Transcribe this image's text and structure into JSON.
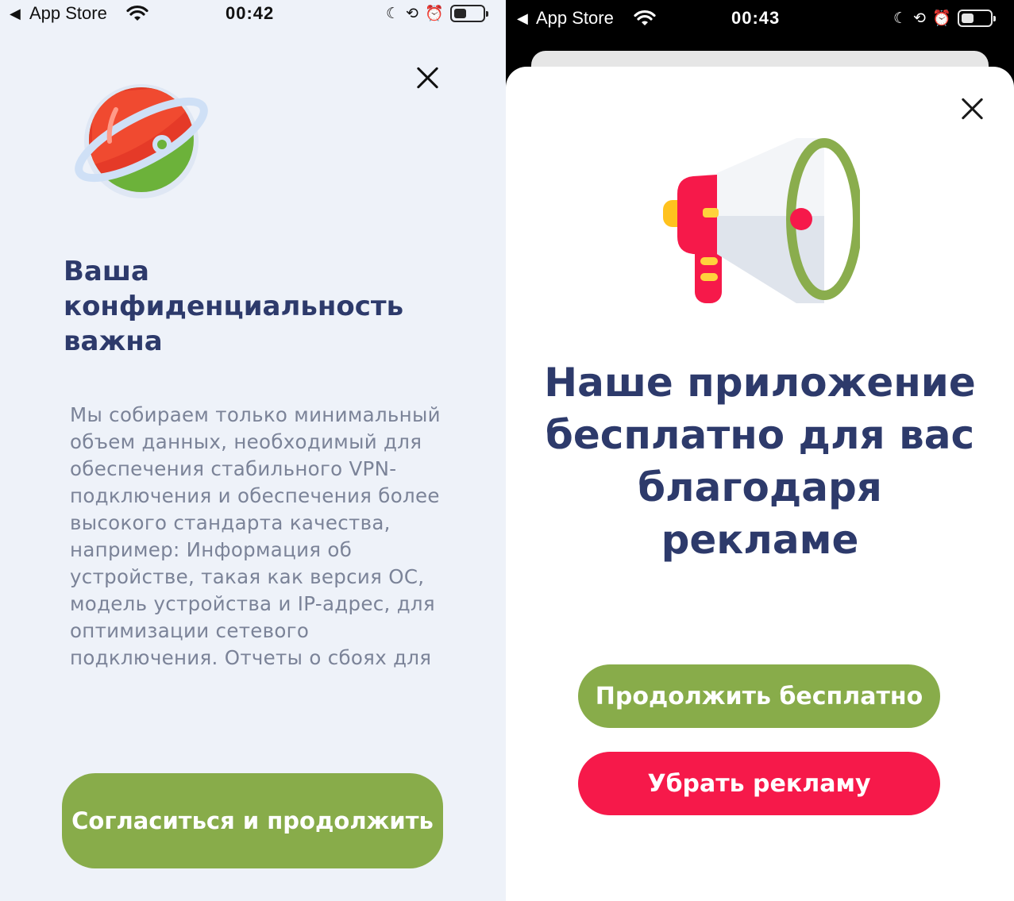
{
  "colors": {
    "title_navy": "#2d3a6b",
    "body_gray": "#7b8398",
    "accent_green": "#88ac4a",
    "accent_red": "#f6194a",
    "left_background": "#eef2f9"
  },
  "left_screen": {
    "status_bar": {
      "back_label": "App Store",
      "time": "00:42",
      "icons": [
        "back-arrow-icon",
        "wifi-icon",
        "moon-icon",
        "rotation-lock-icon",
        "alarm-icon",
        "battery-icon"
      ],
      "battery_level": 0.45
    },
    "logo": "planet-logo-icon",
    "title": "Ваша конфиденциальность важна",
    "body": "Мы собираем только минимальный объем данных, необходимый для обеспечения стабильного VPN-подключения и обеспечения более высокого стандарта качества, например: Информация об устройстве, такая как версия ОС, модель устройства и IP-адрес, для оптимизации сетевого подключения. Отчеты о сбоях для",
    "agree_button": "Согласиться и продолжить"
  },
  "right_screen": {
    "status_bar": {
      "back_label": "App Store",
      "time": "00:43",
      "icons": [
        "back-arrow-icon",
        "wifi-icon",
        "moon-icon",
        "rotation-lock-icon",
        "alarm-icon",
        "battery-icon"
      ],
      "battery_level": 0.45
    },
    "illustration": "megaphone-icon",
    "title": "Наше приложение бесплатно для вас благодаря рекламе",
    "continue_free_button": "Продолжить бесплатно",
    "remove_ads_button": "Убрать рекламу"
  }
}
